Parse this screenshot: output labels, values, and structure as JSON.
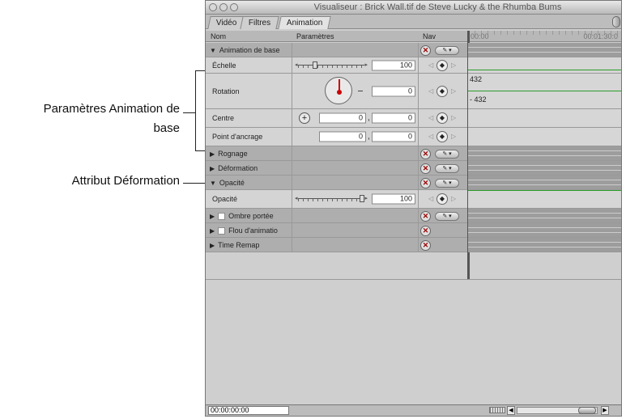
{
  "callouts": {
    "params_line1": "Paramètres Animation de",
    "params_line2": "base",
    "deformation": "Attribut Déformation"
  },
  "window": {
    "title": "Visualiseur : Brick Wall.tif de Steve Lucky & the Rhumba Bums",
    "tabs": [
      "Vidéo",
      "Filtres",
      "Animation"
    ],
    "active_tab": "Animation"
  },
  "columns": {
    "name": "Nom",
    "params": "Paramètres",
    "nav": "Nav",
    "time_start": "00:00",
    "time_end": "00:01:30:0"
  },
  "rows": {
    "anim_base": "Animation de base",
    "echelle": "Échelle",
    "echelle_value": "100",
    "rotation": "Rotation",
    "rotation_value": "0",
    "centre": "Centre",
    "centre_x": "0",
    "centre_y": "0",
    "point_ancrage": "Point d'ancrage",
    "ancrage_x": "0",
    "ancrage_y": "0",
    "rognage": "Rognage",
    "deformation": "Déformation",
    "opacite_group": "Opacité",
    "opacite": "Opacité",
    "opacite_value": "100",
    "ombre": "Ombre portée",
    "flou": "Flou d'animatio",
    "time_remap": "Time Remap"
  },
  "timeline": {
    "rotation_max": "432",
    "rotation_min": "- 432"
  },
  "bottom": {
    "timecode": "00:00:00:00"
  },
  "icons": {
    "reset": "x-circle-icon",
    "menu": "pencil-menu-icon",
    "keyframe": "keyframe-diamond-icon"
  }
}
